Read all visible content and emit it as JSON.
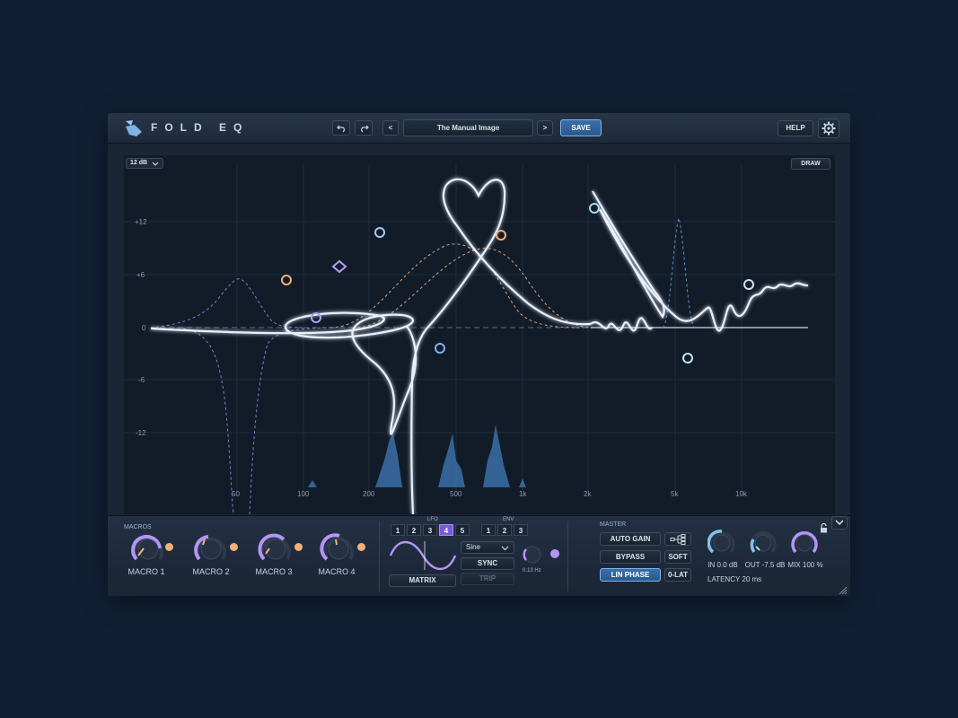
{
  "app": {
    "title": "FOLD EQ"
  },
  "header": {
    "preset_name": "The Manual Image",
    "prev_label": "<",
    "next_label": ">",
    "save_label": "SAVE",
    "help_label": "HELP"
  },
  "editor": {
    "range_label": "12 dB",
    "draw_label": "DRAW",
    "db_labels": [
      "+12",
      "+6",
      "0",
      "-6",
      "-12"
    ],
    "freq_labels": [
      "50",
      "100",
      "200",
      "500",
      "1k",
      "2k",
      "5k",
      "10k"
    ]
  },
  "macros": {
    "section_label": "MACROS",
    "items": [
      {
        "label": "MACRO 1",
        "value": 0.75
      },
      {
        "label": "MACRO 2",
        "value": 0.35
      },
      {
        "label": "MACRO 3",
        "value": 0.6
      },
      {
        "label": "MACRO 4",
        "value": 0.45
      }
    ]
  },
  "modulation": {
    "lfo_label": "LFO",
    "env_label": "ENV",
    "lfo_tabs": [
      "1",
      "2",
      "3",
      "4",
      "5"
    ],
    "lfo_selected": "4",
    "env_tabs": [
      "1",
      "2",
      "3"
    ],
    "waveform": "Sine",
    "sync_label": "SYNC",
    "trip_label": "TRIP",
    "rate_label": "0.13 Hz",
    "matrix_label": "MATRIX"
  },
  "master": {
    "section_label": "MASTER",
    "auto_gain_label": "AUTO GAIN",
    "bypass_label": "BYPASS",
    "lin_phase_label": "LIN PHASE",
    "soft_label": "SOFT",
    "zero_lat_label": "0-LAT",
    "in_label": "IN 0.0 dB",
    "out_label": "OUT -7.5 dB",
    "mix_label": "MIX 100 %",
    "latency_label": "LATENCY 20 ms"
  },
  "colors": {
    "accent": "#7fb2e6",
    "lfo_purple": "#a98cf5",
    "curve": "#e8f1fb",
    "orange": "#f2b07a",
    "background": "#102034"
  }
}
